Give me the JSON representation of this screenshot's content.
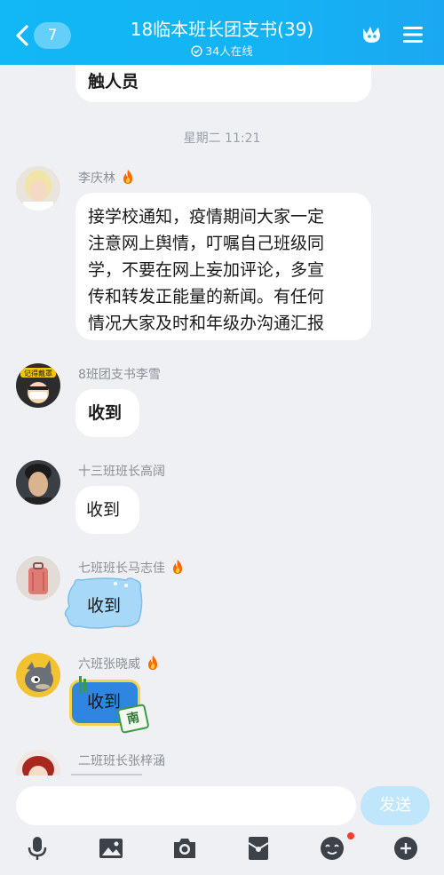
{
  "header": {
    "back_count": "7",
    "title": "18临本班长团支书(39)",
    "online": "34人在线"
  },
  "messages": {
    "prev_tail": "触人员",
    "timestamp": "星期二 11:21",
    "m1": {
      "sender": "李庆林",
      "lines": [
        "接学校通知，疫情期间大家一定",
        "注意网上舆情，叮嘱自己班级同",
        "学，不要在网上妄加评论，多宣",
        "传和转发正能量的新闻。有任何",
        "情况大家及时和年级办沟通汇报"
      ]
    },
    "m2": {
      "sender": "8班团支书李雪",
      "text": "收到",
      "avatar_text": "记得戴罩"
    },
    "m3": {
      "sender": "十三班班长高阔",
      "text": "收到"
    },
    "m4": {
      "sender": "七班班长马志佳",
      "text": "收到"
    },
    "m5": {
      "sender": "六班张晓威",
      "text": "收到",
      "sticker": "南"
    },
    "m6": {
      "sender": "二班班长张梓涵"
    }
  },
  "input": {
    "placeholder": "",
    "send_label": "发送"
  },
  "toolbar": [
    "mic-icon",
    "image-icon",
    "camera-icon",
    "red-packet-icon",
    "emoji-icon",
    "plus-icon"
  ],
  "colors": {
    "header": "#12b7f5",
    "send": "#bfe6fb",
    "background": "#eef0f4",
    "fire": "#ff6a00"
  }
}
